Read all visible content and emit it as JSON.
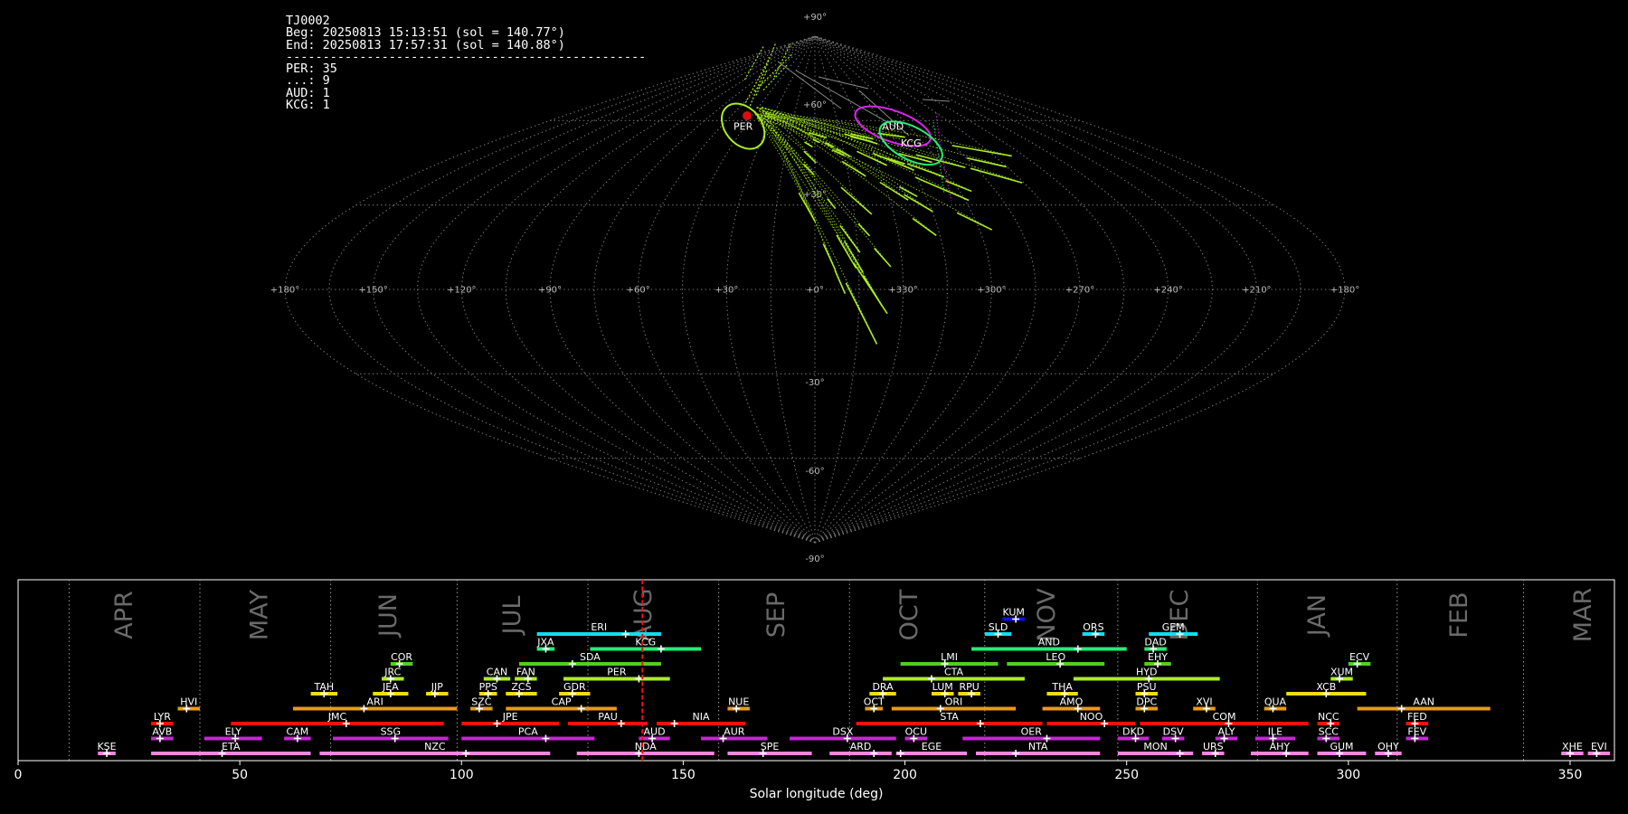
{
  "info": {
    "station": "TJ0002",
    "beg": "Beg: 20250813 15:13:51 (sol = 140.77°)",
    "end": "End: 20250813 17:57:31 (sol = 140.88°)",
    "separator": "-------------------------------------------------",
    "counts": [
      "PER: 35",
      "...: 9",
      "AUD: 1",
      "KCG: 1"
    ]
  },
  "colors": {
    "background": "#000000",
    "grid": "#9a9a9a",
    "per": "#aaee22",
    "aud": "#dd22ee",
    "kcg": "#22ee77",
    "sporadic": "#888888",
    "current": "#ee1111"
  },
  "sky_map": {
    "projection": "sinusoidal",
    "lon_labels": [
      "+180°",
      "+150°",
      "+120°",
      "+90°",
      "+60°",
      "+30°",
      "+0°",
      "+330°",
      "+300°",
      "+270°",
      "+240°",
      "+210°",
      "+180°"
    ],
    "lat_labels": [
      "+90°",
      "+60°",
      "+30°",
      "-30°",
      "-60°",
      "-90°"
    ],
    "showers": [
      {
        "code": "PER",
        "label": "PER",
        "ra": 46,
        "dec": 58,
        "color": "#aaee22"
      },
      {
        "code": "AUD",
        "label": "AUD",
        "ra": 310,
        "dec": 58,
        "color": "#dd22ee"
      },
      {
        "code": "KCG",
        "label": "KCG",
        "ra": 307,
        "dec": 52,
        "color": "#22ee77"
      }
    ]
  },
  "chart_data": {
    "type": "timeline",
    "xlabel": "Solar longitude (deg)",
    "xlim": [
      0,
      360
    ],
    "xticks": [
      0,
      50,
      100,
      150,
      200,
      250,
      300,
      350
    ],
    "current_sol": 140.8,
    "months": [
      {
        "label": "APR",
        "start": 11.5,
        "center": 24
      },
      {
        "label": "MAY",
        "start": 41,
        "center": 54.5
      },
      {
        "label": "JUN",
        "start": 70.5,
        "center": 83.5
      },
      {
        "label": "JUL",
        "start": 99,
        "center": 111.5
      },
      {
        "label": "AUG",
        "start": 128.5,
        "center": 141
      },
      {
        "label": "SEP",
        "start": 158,
        "center": 171
      },
      {
        "label": "OCT",
        "start": 187.5,
        "center": 201
      },
      {
        "label": "NOV",
        "start": 218,
        "center": 232
      },
      {
        "label": "DEC",
        "start": 248,
        "center": 262
      },
      {
        "label": "JAN",
        "start": 279.5,
        "center": 293
      },
      {
        "label": "FEB",
        "start": 311,
        "center": 325
      },
      {
        "label": "MAR",
        "start": 339.5,
        "center": 353
      }
    ],
    "showers": [
      {
        "code": "KUM",
        "start": 222,
        "end": 227,
        "peak": 225,
        "row": 9,
        "color": "#1111dd"
      },
      {
        "code": "ERI",
        "start": 117,
        "end": 145,
        "peak": 137,
        "row": 8,
        "color": "#11ddee"
      },
      {
        "code": "SLD",
        "start": 218,
        "end": 224,
        "peak": 221,
        "row": 8,
        "color": "#11ddee"
      },
      {
        "code": "ORS",
        "start": 240,
        "end": 245,
        "peak": 243,
        "row": 8,
        "color": "#11ddee"
      },
      {
        "code": "GEM",
        "start": 255,
        "end": 266,
        "peak": 262,
        "row": 8,
        "color": "#11ddee"
      },
      {
        "code": "JXA",
        "start": 117,
        "end": 121,
        "peak": 119,
        "row": 7,
        "color": "#22ee77"
      },
      {
        "code": "KCG",
        "start": 129,
        "end": 154,
        "peak": 145,
        "row": 7,
        "color": "#22ee77"
      },
      {
        "code": "AND",
        "start": 215,
        "end": 250,
        "peak": 239,
        "row": 7,
        "color": "#22ee77"
      },
      {
        "code": "DAD",
        "start": 254,
        "end": 259,
        "peak": 256,
        "row": 7,
        "color": "#22ee77"
      },
      {
        "code": "COR",
        "start": 84,
        "end": 89,
        "peak": 86,
        "row": 6,
        "color": "#55cc22"
      },
      {
        "code": "SDA",
        "start": 113,
        "end": 145,
        "peak": 125,
        "row": 6,
        "color": "#55cc22"
      },
      {
        "code": "LMI",
        "start": 199,
        "end": 221,
        "peak": 209,
        "row": 6,
        "color": "#55cc22"
      },
      {
        "code": "LEO",
        "start": 223,
        "end": 245,
        "peak": 235,
        "row": 6,
        "color": "#55cc22"
      },
      {
        "code": "EHY",
        "start": 254,
        "end": 260,
        "peak": 257,
        "row": 6,
        "color": "#55cc22"
      },
      {
        "code": "ECV",
        "start": 300,
        "end": 305,
        "peak": 302,
        "row": 6,
        "color": "#55cc22"
      },
      {
        "code": "JRC",
        "start": 82,
        "end": 87,
        "peak": 84,
        "row": 5,
        "color": "#aaee22"
      },
      {
        "code": "CAN",
        "start": 105,
        "end": 111,
        "peak": 108,
        "row": 5,
        "color": "#aaee22"
      },
      {
        "code": "FAN",
        "start": 112,
        "end": 117,
        "peak": 115,
        "row": 5,
        "color": "#aaee22"
      },
      {
        "code": "PER",
        "start": 123,
        "end": 147,
        "peak": 140,
        "row": 5,
        "color": "#aaee22"
      },
      {
        "code": "CTA",
        "start": 195,
        "end": 227,
        "peak": 206,
        "row": 5,
        "color": "#aaee22"
      },
      {
        "code": "HYD",
        "start": 238,
        "end": 271,
        "peak": 255,
        "row": 5,
        "color": "#aaee22"
      },
      {
        "code": "XUM",
        "start": 296,
        "end": 301,
        "peak": 298,
        "row": 5,
        "color": "#aaee22"
      },
      {
        "code": "TAH",
        "start": 66,
        "end": 72,
        "peak": 69,
        "row": 4,
        "color": "#eedd11"
      },
      {
        "code": "JEA",
        "start": 80,
        "end": 88,
        "peak": 84,
        "row": 4,
        "color": "#eedd11"
      },
      {
        "code": "JIP",
        "start": 92,
        "end": 97,
        "peak": 94,
        "row": 4,
        "color": "#eedd11"
      },
      {
        "code": "PPS",
        "start": 104,
        "end": 108,
        "peak": 106,
        "row": 4,
        "color": "#eedd11"
      },
      {
        "code": "ZCS",
        "start": 110,
        "end": 117,
        "peak": 113,
        "row": 4,
        "color": "#eedd11"
      },
      {
        "code": "GDR",
        "start": 122,
        "end": 129,
        "peak": 125,
        "row": 4,
        "color": "#eedd11"
      },
      {
        "code": "DRA",
        "start": 192,
        "end": 198,
        "peak": 195,
        "row": 4,
        "color": "#eedd11"
      },
      {
        "code": "LUM",
        "start": 206,
        "end": 211,
        "peak": 209,
        "row": 4,
        "color": "#eedd11"
      },
      {
        "code": "RPU",
        "start": 212,
        "end": 217,
        "peak": 215,
        "row": 4,
        "color": "#eedd11"
      },
      {
        "code": "THA",
        "start": 232,
        "end": 239,
        "peak": 236,
        "row": 4,
        "color": "#eedd11"
      },
      {
        "code": "PSU",
        "start": 252,
        "end": 257,
        "peak": 254,
        "row": 4,
        "color": "#eedd11"
      },
      {
        "code": "XCB",
        "start": 286,
        "end": 304,
        "peak": 295,
        "row": 4,
        "color": "#eedd11"
      },
      {
        "code": "HVI",
        "start": 36,
        "end": 41,
        "peak": 38,
        "row": 3,
        "color": "#ee9911"
      },
      {
        "code": "ARI",
        "start": 62,
        "end": 99,
        "peak": 78,
        "row": 3,
        "color": "#ee9911"
      },
      {
        "code": "SZC",
        "start": 102,
        "end": 107,
        "peak": 104,
        "row": 3,
        "color": "#ee9911"
      },
      {
        "code": "CAP",
        "start": 110,
        "end": 135,
        "peak": 127,
        "row": 3,
        "color": "#ee9911"
      },
      {
        "code": "NUE",
        "start": 160,
        "end": 165,
        "peak": 162,
        "row": 3,
        "color": "#ee9911"
      },
      {
        "code": "OCT",
        "start": 191,
        "end": 195,
        "peak": 193,
        "row": 3,
        "color": "#ee9911"
      },
      {
        "code": "ORI",
        "start": 197,
        "end": 225,
        "peak": 208,
        "row": 3,
        "color": "#ee9911"
      },
      {
        "code": "AMO",
        "start": 231,
        "end": 244,
        "peak": 239,
        "row": 3,
        "color": "#ee9911"
      },
      {
        "code": "DPC",
        "start": 252,
        "end": 257,
        "peak": 254,
        "row": 3,
        "color": "#ee9911"
      },
      {
        "code": "XVI",
        "start": 265,
        "end": 270,
        "peak": 268,
        "row": 3,
        "color": "#ee9911"
      },
      {
        "code": "QUA",
        "start": 281,
        "end": 286,
        "peak": 283,
        "row": 3,
        "color": "#ee9911"
      },
      {
        "code": "AAN",
        "start": 302,
        "end": 332,
        "peak": 312,
        "row": 3,
        "color": "#ee9911"
      },
      {
        "code": "LYR",
        "start": 30,
        "end": 35,
        "peak": 32,
        "row": 2,
        "color": "#ee1111"
      },
      {
        "code": "JMC",
        "start": 48,
        "end": 96,
        "peak": 74,
        "row": 2,
        "color": "#ee1111"
      },
      {
        "code": "JPE",
        "start": 100,
        "end": 122,
        "peak": 108,
        "row": 2,
        "color": "#ee1111"
      },
      {
        "code": "PAU",
        "start": 124,
        "end": 142,
        "peak": 136,
        "row": 2,
        "color": "#ee1111"
      },
      {
        "code": "NIA",
        "start": 144,
        "end": 164,
        "peak": 148,
        "row": 2,
        "color": "#ee1111"
      },
      {
        "code": "STA",
        "start": 189,
        "end": 231,
        "peak": 217,
        "row": 2,
        "color": "#ee1111"
      },
      {
        "code": "NOO",
        "start": 232,
        "end": 252,
        "peak": 245,
        "row": 2,
        "color": "#ee1111"
      },
      {
        "code": "COM",
        "start": 253,
        "end": 291,
        "peak": 273,
        "row": 2,
        "color": "#ee1111"
      },
      {
        "code": "NCC",
        "start": 293,
        "end": 298,
        "peak": 296,
        "row": 2,
        "color": "#ee1111"
      },
      {
        "code": "FED",
        "start": 313,
        "end": 318,
        "peak": 315,
        "row": 2,
        "color": "#ee1111"
      },
      {
        "code": "AVB",
        "start": 30,
        "end": 35,
        "peak": 32,
        "row": 1,
        "color": "#cc22dd"
      },
      {
        "code": "ELY",
        "start": 42,
        "end": 55,
        "peak": 49,
        "row": 1,
        "color": "#cc22dd"
      },
      {
        "code": "CAM",
        "start": 60,
        "end": 66,
        "peak": 63,
        "row": 1,
        "color": "#cc22dd"
      },
      {
        "code": "SSG",
        "start": 71,
        "end": 97,
        "peak": 85,
        "row": 1,
        "color": "#cc22dd"
      },
      {
        "code": "PCA",
        "start": 100,
        "end": 130,
        "peak": 119,
        "row": 1,
        "color": "#cc22dd"
      },
      {
        "code": "AUD",
        "start": 140,
        "end": 147,
        "peak": 143,
        "row": 1,
        "color": "#cc22dd"
      },
      {
        "code": "AUR",
        "start": 154,
        "end": 169,
        "peak": 159,
        "row": 1,
        "color": "#cc22dd"
      },
      {
        "code": "DSX",
        "start": 174,
        "end": 198,
        "peak": 187,
        "row": 1,
        "color": "#cc22dd"
      },
      {
        "code": "OCU",
        "start": 200,
        "end": 205,
        "peak": 202,
        "row": 1,
        "color": "#cc22dd"
      },
      {
        "code": "OER",
        "start": 213,
        "end": 244,
        "peak": 232,
        "row": 1,
        "color": "#cc22dd"
      },
      {
        "code": "DKD",
        "start": 248,
        "end": 255,
        "peak": 252,
        "row": 1,
        "color": "#cc22dd"
      },
      {
        "code": "DSV",
        "start": 258,
        "end": 263,
        "peak": 261,
        "row": 1,
        "color": "#cc22dd"
      },
      {
        "code": "ALY",
        "start": 270,
        "end": 275,
        "peak": 272,
        "row": 1,
        "color": "#cc22dd"
      },
      {
        "code": "ILE",
        "start": 279,
        "end": 288,
        "peak": 283,
        "row": 1,
        "color": "#cc22dd"
      },
      {
        "code": "SCC",
        "start": 293,
        "end": 298,
        "peak": 295,
        "row": 1,
        "color": "#cc22dd"
      },
      {
        "code": "FEV",
        "start": 313,
        "end": 318,
        "peak": 315,
        "row": 1,
        "color": "#cc22dd"
      },
      {
        "code": "KSE",
        "start": 18,
        "end": 22,
        "peak": 20,
        "row": 0,
        "color": "#ee88dd"
      },
      {
        "code": "ETA",
        "start": 30,
        "end": 66,
        "peak": 46,
        "row": 0,
        "color": "#ee88dd"
      },
      {
        "code": "NZC",
        "start": 68,
        "end": 120,
        "peak": 101,
        "row": 0,
        "color": "#ee88dd"
      },
      {
        "code": "NDA",
        "start": 126,
        "end": 157,
        "peak": 140,
        "row": 0,
        "color": "#ee88dd"
      },
      {
        "code": "SPE",
        "start": 160,
        "end": 179,
        "peak": 168,
        "row": 0,
        "color": "#ee88dd"
      },
      {
        "code": "ARD",
        "start": 183,
        "end": 197,
        "peak": 193,
        "row": 0,
        "color": "#ee88dd"
      },
      {
        "code": "EGE",
        "start": 198,
        "end": 214,
        "peak": 199,
        "row": 0,
        "color": "#ee88dd"
      },
      {
        "code": "NTA",
        "start": 216,
        "end": 244,
        "peak": 225,
        "row": 0,
        "color": "#ee88dd"
      },
      {
        "code": "MON",
        "start": 248,
        "end": 265,
        "peak": 262,
        "row": 0,
        "color": "#ee88dd"
      },
      {
        "code": "URS",
        "start": 267,
        "end": 272,
        "peak": 270,
        "row": 0,
        "color": "#ee88dd"
      },
      {
        "code": "AHY",
        "start": 278,
        "end": 291,
        "peak": 286,
        "row": 0,
        "color": "#ee88dd"
      },
      {
        "code": "GUM",
        "start": 293,
        "end": 304,
        "peak": 298,
        "row": 0,
        "color": "#ee88dd"
      },
      {
        "code": "OHY",
        "start": 306,
        "end": 312,
        "peak": 309,
        "row": 0,
        "color": "#ee88dd"
      },
      {
        "code": "XHE",
        "start": 348,
        "end": 353,
        "peak": 350,
        "row": 0,
        "color": "#ee88dd"
      },
      {
        "code": "EVI",
        "start": 354,
        "end": 359,
        "peak": 356,
        "row": 0,
        "color": "#ee88dd"
      }
    ]
  }
}
